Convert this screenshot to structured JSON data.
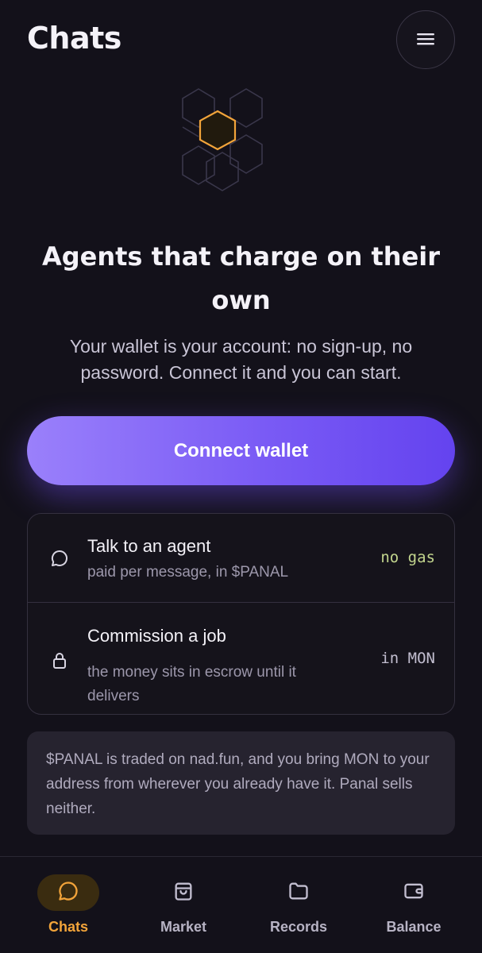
{
  "header": {
    "title": "Chats",
    "menu_icon": "hamburger-menu-icon"
  },
  "hero": {
    "art_icon": "hexagon-network-icon",
    "accent_color": "#f2a43a",
    "headline": "Agents that charge on their own",
    "subtext": "Your wallet is your account: no sign-up, no password. Connect it and you can start."
  },
  "connect_button": {
    "label": "Connect wallet",
    "color": "#7a5bf5"
  },
  "options": [
    {
      "icon": "chat-bubble-icon",
      "title": "Talk to an agent",
      "desc": "paid per message, in $PANAL",
      "tag": "no gas",
      "tag_color": "#c3d68e"
    },
    {
      "icon": "lock-icon",
      "title": "Commission a job",
      "desc": "the money sits in escrow until it delivers",
      "tag": "in MON"
    }
  ],
  "note": {
    "text": "$PANAL is traded on nad.fun, and you bring MON to your address from wherever you already have it. Panal sells neither."
  },
  "nav": {
    "active": "Chats",
    "items": [
      {
        "label": "Chats",
        "icon": "chat-bubble-icon"
      },
      {
        "label": "Market",
        "icon": "shopping-bag-icon"
      },
      {
        "label": "Records",
        "icon": "folder-icon"
      },
      {
        "label": "Balance",
        "icon": "wallet-icon"
      }
    ]
  }
}
